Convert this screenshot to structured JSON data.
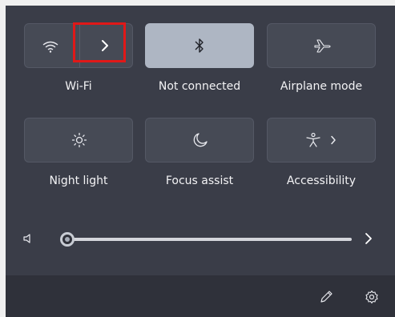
{
  "tiles": {
    "wifi": {
      "label": "Wi-Fi",
      "state": "off"
    },
    "bluetooth": {
      "label": "Not connected",
      "state": "on"
    },
    "airplane": {
      "label": "Airplane mode",
      "state": "off"
    },
    "night_light": {
      "label": "Night light",
      "state": "off"
    },
    "focus_assist": {
      "label": "Focus assist",
      "state": "off"
    },
    "accessibility": {
      "label": "Accessibility",
      "state": "off"
    }
  },
  "volume": {
    "level": 0.0
  },
  "icons": {
    "wifi": "wifi-icon",
    "wifi_expand": "chevron-right-icon",
    "bluetooth": "bluetooth-icon",
    "airplane": "airplane-icon",
    "night_light": "sun-icon",
    "focus_assist": "moon-icon",
    "accessibility": "accessibility-icon",
    "volume": "speaker-icon",
    "volume_expand": "chevron-right-icon",
    "edit": "pencil-icon",
    "settings": "gear-icon"
  },
  "colors": {
    "panel": "#3a3d48",
    "tile": "#464a55",
    "tile_active": "#aeb6c3",
    "highlight": "#e01818"
  }
}
